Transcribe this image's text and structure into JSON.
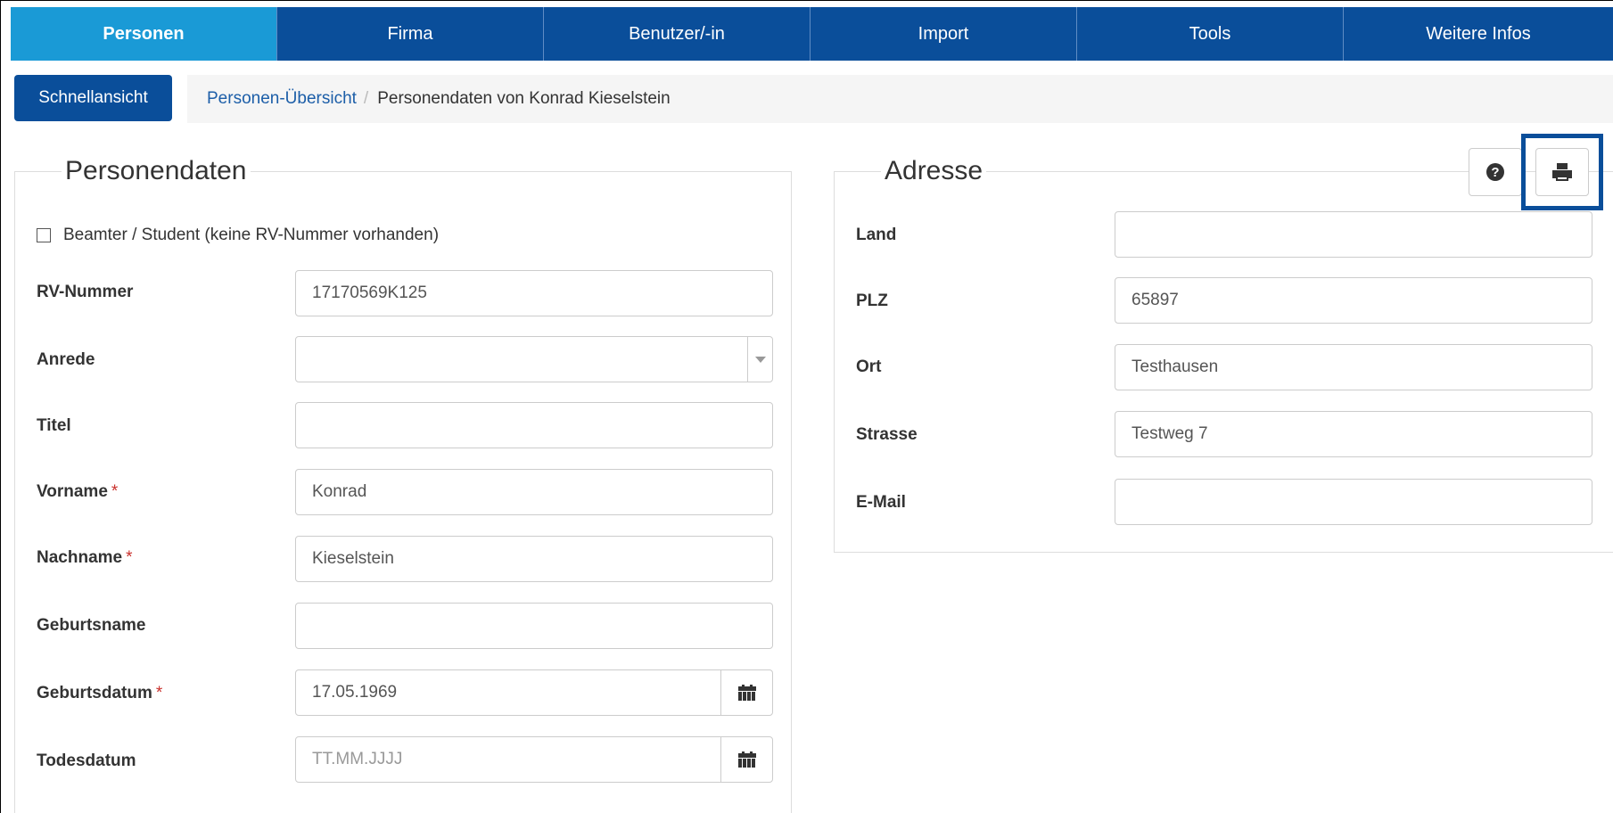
{
  "nav": {
    "tabs": [
      {
        "label": "Personen",
        "active": true
      },
      {
        "label": "Firma",
        "active": false
      },
      {
        "label": "Benutzer/-in",
        "active": false
      },
      {
        "label": "Import",
        "active": false
      },
      {
        "label": "Tools",
        "active": false
      },
      {
        "label": "Weitere Infos",
        "active": false
      }
    ]
  },
  "toolbar": {
    "quick_view_label": "Schnellansicht"
  },
  "breadcrumb": {
    "link": "Personen-Übersicht",
    "separator": "/",
    "current": "Personendaten von Konrad Kieselstein"
  },
  "personendaten": {
    "legend": "Personendaten",
    "checkbox_label": "Beamter / Student (keine RV-Nummer vorhanden)",
    "checkbox_checked": false,
    "required_marker": "*",
    "fields": {
      "rv_nummer": {
        "label": "RV-Nummer",
        "value": "17170569K125"
      },
      "anrede": {
        "label": "Anrede",
        "value": ""
      },
      "titel": {
        "label": "Titel",
        "value": ""
      },
      "vorname": {
        "label": "Vorname",
        "value": "Konrad"
      },
      "nachname": {
        "label": "Nachname",
        "value": "Kieselstein"
      },
      "geburtsname": {
        "label": "Geburtsname",
        "value": ""
      },
      "geburtsdatum": {
        "label": "Geburtsdatum",
        "value": "17.05.1969"
      },
      "todesdatum": {
        "label": "Todesdatum",
        "value": "",
        "placeholder": "TT.MM.JJJJ"
      }
    }
  },
  "adresse": {
    "legend": "Adresse",
    "fields": {
      "land": {
        "label": "Land",
        "value": ""
      },
      "plz": {
        "label": "PLZ",
        "value": "65897"
      },
      "ort": {
        "label": "Ort",
        "value": "Testhausen"
      },
      "strasse": {
        "label": "Strasse",
        "value": "Testweg 7"
      },
      "email": {
        "label": "E-Mail",
        "value": ""
      }
    }
  },
  "icons": {
    "help": "question-circle-icon",
    "print": "print-icon",
    "calendar": "calendar-icon",
    "select": "chevron-down-icon",
    "help_glyph": "?"
  },
  "colors": {
    "nav_bg": "#0a4e9a",
    "nav_active": "#1a9ad6",
    "link": "#1c5ea8",
    "required": "#c9302c"
  }
}
